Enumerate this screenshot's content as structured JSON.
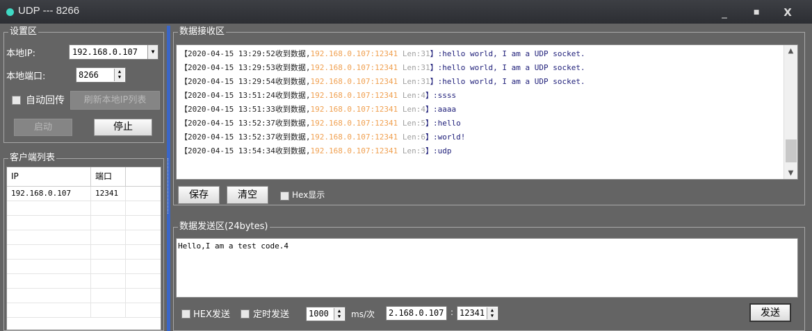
{
  "window": {
    "title": "UDP --- 8266",
    "minimize": "_",
    "maximize": "■",
    "close": "X"
  },
  "settings": {
    "group_label": "设置区",
    "local_ip_label": "本地IP:",
    "local_ip_value": "192.168.0.107",
    "local_port_label": "本地端口:",
    "local_port_value": "8266",
    "auto_reply_label": "自动回传",
    "refresh_button": "刷新本地IP列表",
    "start_button": "启动",
    "stop_button": "停止"
  },
  "clients": {
    "group_label": "客户端列表",
    "columns": [
      "IP",
      "端口"
    ],
    "rows": [
      {
        "ip": "192.168.0.107",
        "port": "12341"
      }
    ]
  },
  "receive": {
    "group_label": "数据接收区",
    "lines": [
      {
        "ts": "【2020-04-15 13:29:52收到数据,",
        "src": "192.168.0.107:12341",
        "len": " Len:31",
        "msg": "】:hello world, I am a UDP socket."
      },
      {
        "ts": "【2020-04-15 13:29:53收到数据,",
        "src": "192.168.0.107:12341",
        "len": " Len:31",
        "msg": "】:hello world, I am a UDP socket."
      },
      {
        "ts": "【2020-04-15 13:29:54收到数据,",
        "src": "192.168.0.107:12341",
        "len": " Len:31",
        "msg": "】:hello world, I am a UDP socket."
      },
      {
        "ts": "【2020-04-15 13:51:24收到数据,",
        "src": "192.168.0.107:12341",
        "len": " Len:4",
        "msg": "】:ssss"
      },
      {
        "ts": "【2020-04-15 13:51:33收到数据,",
        "src": "192.168.0.107:12341",
        "len": " Len:4",
        "msg": "】:aaaa"
      },
      {
        "ts": "【2020-04-15 13:52:37收到数据,",
        "src": "192.168.0.107:12341",
        "len": " Len:5",
        "msg": "】:hello"
      },
      {
        "ts": "【2020-04-15 13:52:37收到数据,",
        "src": "192.168.0.107:12341",
        "len": " Len:6",
        "msg": "】:world!"
      },
      {
        "ts": "【2020-04-15 13:54:34收到数据,",
        "src": "192.168.0.107:12341",
        "len": " Len:3",
        "msg": "】:udp"
      }
    ],
    "save_button": "保存",
    "clear_button": "清空",
    "hex_display_label": "Hex显示"
  },
  "send": {
    "group_label": "数据发送区(24bytes)",
    "text": "Hello,I am a test code.4",
    "hex_send_label": "HEX发送",
    "timed_send_label": "定时发送",
    "interval_value": "1000",
    "interval_unit": "ms/次",
    "target_ip": "2.168.0.107",
    "colon": ":",
    "target_port": "12341",
    "send_button": "发送"
  },
  "colors": {
    "accent": "#3a66c8",
    "source": "#f0a050",
    "title_dot": "#3fd9c4"
  }
}
